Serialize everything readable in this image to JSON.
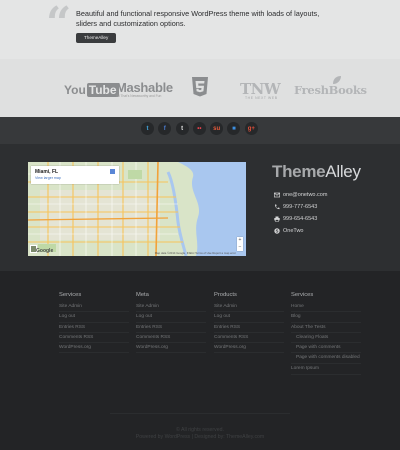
{
  "testimonial": {
    "quote": "Beautiful and functional responsive WordPress theme with loads of layouts, sliders and customization options.",
    "author": "ThemeAlley"
  },
  "clients": {
    "youtube_you": "You",
    "youtube_tube": "Tube",
    "mashable": "Mashable",
    "mashable_sub": "All That's Newsworthy and Fun",
    "tnw": "TNW",
    "tnw_sub": "THE NEXT WEB",
    "freshbooks": "FreshBooks"
  },
  "social": [
    {
      "name": "twitter",
      "glyph": "t",
      "color": "#42a8e0"
    },
    {
      "name": "facebook",
      "glyph": "f",
      "color": "#4a7bd0"
    },
    {
      "name": "tumblr",
      "glyph": "t",
      "color": "#e8e8e8"
    },
    {
      "name": "flickr",
      "glyph": "••",
      "color": "#e8434e"
    },
    {
      "name": "stumbleupon",
      "glyph": "su",
      "color": "#e85a3a"
    },
    {
      "name": "delicious",
      "glyph": "■",
      "color": "#3d8fe0"
    },
    {
      "name": "google-plus",
      "glyph": "g+",
      "color": "#e2503a"
    }
  ],
  "map": {
    "title": "Miami, FL",
    "link": "View larger map",
    "google": "Google",
    "attribution": "Map data ©2014 Google, INEGI   Terms of Use   Report a map error"
  },
  "brand": {
    "theme": "Theme",
    "alley": "Alley"
  },
  "contact": {
    "email": "one@onetwo.com",
    "phone": "999-777-6543",
    "fax": "999-654-6543",
    "skype": "OneTwo"
  },
  "widgets": [
    {
      "title": "Services",
      "items": [
        "Site Admin",
        "Log out",
        "Entries RSS",
        "Comments RSS",
        "WordPress.org"
      ]
    },
    {
      "title": "Meta",
      "items": [
        "Site Admin",
        "Log out",
        "Entries RSS",
        "Comments RSS",
        "WordPress.org"
      ]
    },
    {
      "title": "Products",
      "items": [
        "Site Admin",
        "Log out",
        "Entries RSS",
        "Comments RSS",
        "WordPress.org"
      ]
    },
    {
      "title": "Services",
      "items": [
        "Home",
        "Blog",
        "About The Tests",
        "Clearing Floats",
        "Page with comments",
        "Page with comments disabled",
        "Lorem Ipsum"
      ]
    }
  ],
  "footer": {
    "copyright": "© All rights reserved.",
    "credits": "Powered by WordPress | Designed by: ThemeAlley.com"
  },
  "colors": {
    "page_bg": "#232426",
    "testimonial_bg": "#e4e5e5",
    "contact_bg": "#2d2f31",
    "social_bar_bg": "#37393b"
  }
}
